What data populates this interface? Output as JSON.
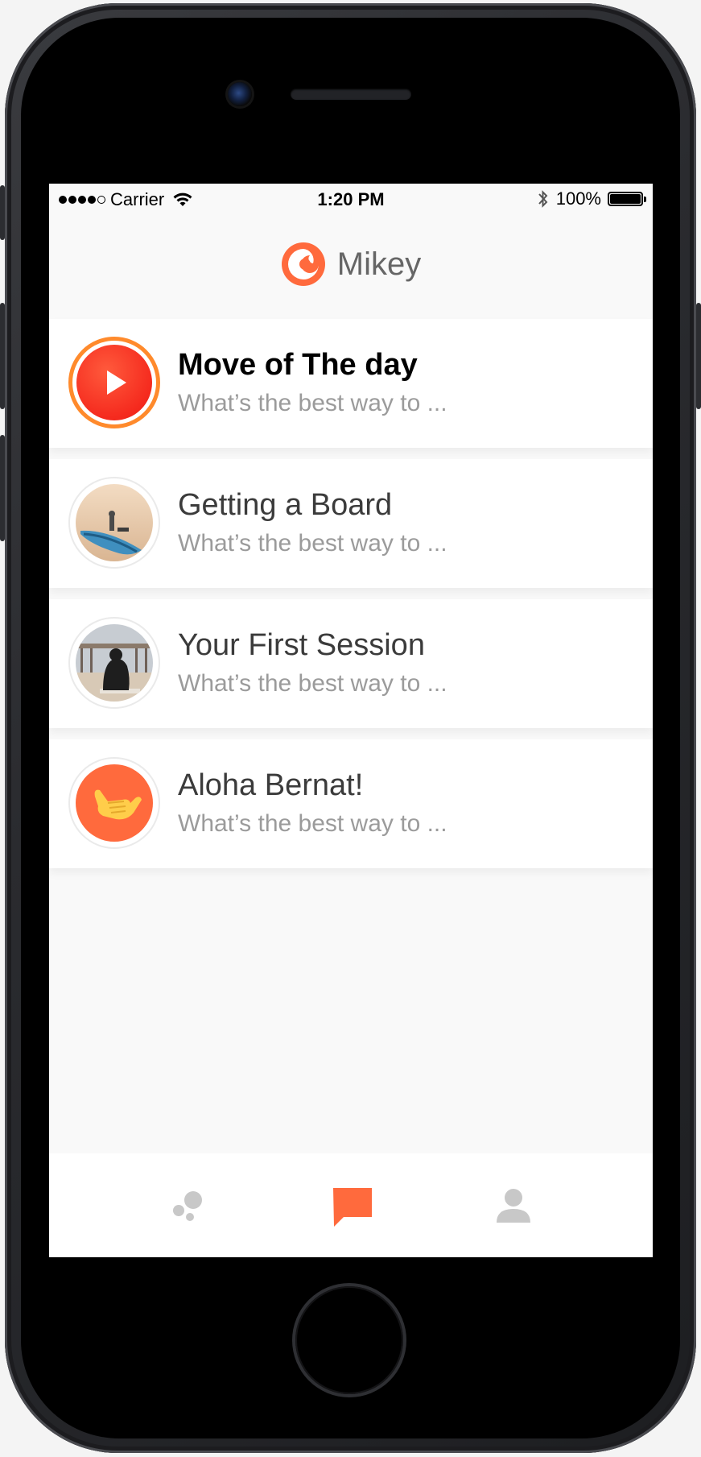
{
  "status_bar": {
    "carrier": "Carrier",
    "time": "1:20 PM",
    "battery": "100%"
  },
  "nav": {
    "title": "Mikey",
    "logo_icon": "wave-logo-icon"
  },
  "colors": {
    "accent": "#ff6a3d",
    "featured_ring": "#ff8a2c",
    "title_dark": "#3b3b3b",
    "subtitle_gray": "#9b9b9b",
    "tab_inactive": "#c8c8c8"
  },
  "items": [
    {
      "title": "Move of The day",
      "subtitle": "What’s the best way to ...",
      "icon": "play-icon",
      "featured": true
    },
    {
      "title": "Getting a Board",
      "subtitle": "What’s the best way to ...",
      "icon": "surfboard-photo"
    },
    {
      "title": "Your First Session",
      "subtitle": "What’s the best way to ...",
      "icon": "surfer-photo"
    },
    {
      "title": "Aloha Bernat!",
      "subtitle": "What’s the best way to ...",
      "icon": "shaka-hand-icon"
    }
  ],
  "tabs": [
    {
      "name": "discover",
      "icon": "bubbles-icon",
      "active": false
    },
    {
      "name": "chat",
      "icon": "chat-bubble-icon",
      "active": true
    },
    {
      "name": "profile",
      "icon": "person-icon",
      "active": false
    }
  ]
}
